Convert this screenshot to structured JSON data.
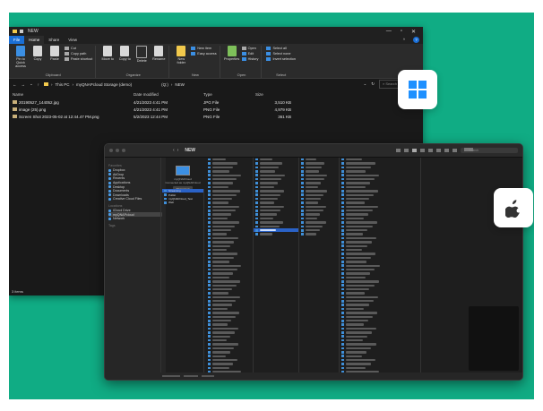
{
  "colors": {
    "background": "#10ac84",
    "win_accent": "#1a6fd6",
    "selection": "#2a62c7"
  },
  "windows": {
    "title": "NEW",
    "controls": [
      "—",
      "▫",
      "✕"
    ],
    "menu": {
      "file": "File",
      "home": "Home",
      "share": "Share",
      "view": "View"
    },
    "ribbon": {
      "clipboard": {
        "pin": "Pin to Quick access",
        "copy": "Copy",
        "paste": "Paste",
        "cut": "Cut",
        "copy_path": "Copy path",
        "paste_shortcut": "Paste shortcut",
        "label": "Clipboard"
      },
      "organize": {
        "move_to": "Move to",
        "copy_to": "Copy to",
        "delete": "Delete",
        "rename": "Rename",
        "label": "Organize"
      },
      "new": {
        "new_folder": "New folder",
        "new_item": "New item",
        "easy_access": "Easy access",
        "label": "New"
      },
      "open": {
        "properties": "Properties",
        "open": "Open",
        "edit": "Edit",
        "history": "History",
        "label": "Open"
      },
      "select": {
        "select_all": "Select all",
        "select_none": "Select none",
        "invert": "Invert selection",
        "label": "Select"
      }
    },
    "address": {
      "this_pc": "This PC",
      "storage": "myQNAPcloud Storage (demo)",
      "drive": "(Q:)",
      "folder": "NEW",
      "search_placeholder": "Search"
    },
    "columns": {
      "name": "Name",
      "date": "Date modified",
      "type": "Type",
      "size": "Size"
    },
    "files": [
      {
        "name": "20190527_144052.jpg",
        "date": "4/21/2023 4:41 PM",
        "type": "JPG File",
        "size": "3,510 KB"
      },
      {
        "name": "image (25).png",
        "date": "4/21/2023 4:41 PM",
        "type": "PNG File",
        "size": "4,979 KB"
      },
      {
        "name": "Screen Shot 2023-05-02 at 12:44.47 PM.png",
        "date": "5/2/2023 12:44 PM",
        "type": "PNG File",
        "size": "361 KB"
      }
    ],
    "status": "3 items"
  },
  "badges": {
    "windows_icon": "windows-logo",
    "apple_icon": "apple-logo"
  },
  "mac": {
    "title": "NEW",
    "search_placeholder": "Search",
    "sidebar": {
      "favorites_label": "Favorites",
      "favorites": [
        "Dropbox",
        "AirDrop",
        "Recents",
        "Applications",
        "Desktop",
        "Documents",
        "Downloads",
        "Creative Cloud Files"
      ],
      "locations_label": "Locations",
      "locations": [
        "iCloud Drive",
        "myQNAPcloud",
        "Network"
      ],
      "tags_label": "Tags"
    },
    "device": {
      "name": "myQNAPcloud",
      "status": "Connected as myQNAPcloud",
      "button": "Disconnect"
    },
    "drives": [
      "Streaming",
      "Public",
      "myQNAPcloud_Test",
      "Web"
    ]
  }
}
